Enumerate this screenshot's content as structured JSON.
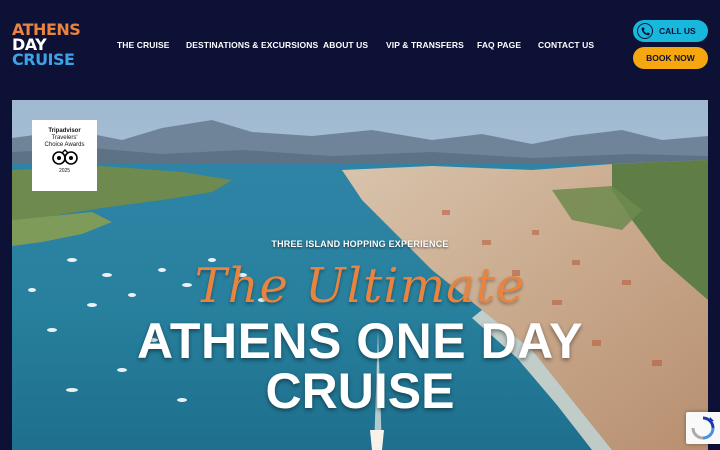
{
  "brand": {
    "line1": "ATHENS",
    "line2": "DAY",
    "line3": "CRUISE"
  },
  "nav": {
    "items": [
      "THE CRUISE",
      "DESTINATIONS & EXCURSIONS",
      "ABOUT US",
      "VIP & TRANSFERS",
      "FAQ PAGE",
      "CONTACT US"
    ]
  },
  "actions": {
    "call_label": "CALL US",
    "book_label": "BOOK NOW"
  },
  "award": {
    "line1": "Tripadvisor",
    "line2": "Travelers'",
    "line3": "Choice Awards",
    "year": "2025"
  },
  "hero": {
    "kicker": "THREE ISLAND HOPPING EXPERIENCE",
    "script": "The Ultimate",
    "headline_line1": "ATHENS ONE DAY",
    "headline_line2": "CRUISE"
  },
  "colors": {
    "navy": "#0d1136",
    "orange": "#e8843f",
    "blue": "#3ea3e5",
    "cyan": "#17b8dc",
    "yellow": "#f6a70f"
  },
  "icons": {
    "call": "phone-icon",
    "award": "tripadvisor-owl-icon",
    "captcha": "recaptcha-icon"
  }
}
